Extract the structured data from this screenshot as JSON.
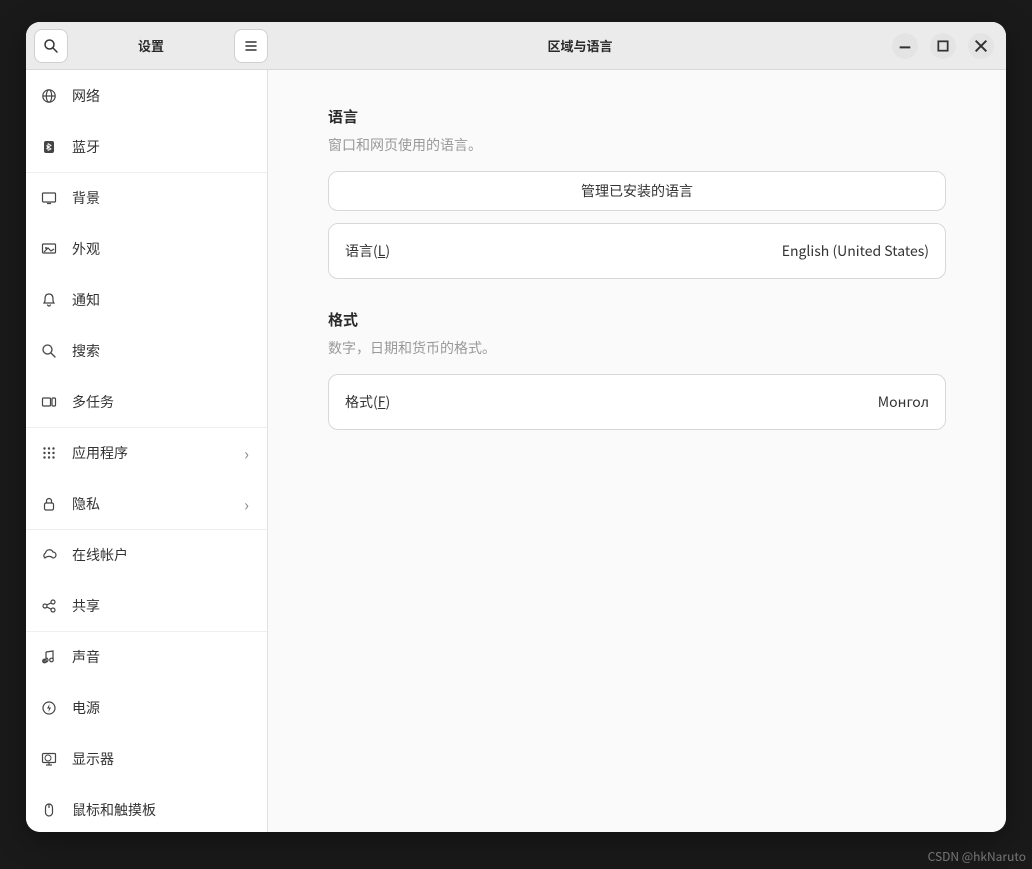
{
  "header": {
    "sidebar_title": "设置",
    "main_title": "区域与语言"
  },
  "sidebar": {
    "items": [
      {
        "id": "network",
        "label": "网络",
        "chevron": false,
        "sep": false
      },
      {
        "id": "bluetooth",
        "label": "蓝牙",
        "chevron": false,
        "sep": false
      },
      {
        "id": "background",
        "label": "背景",
        "chevron": false,
        "sep": true
      },
      {
        "id": "appearance",
        "label": "外观",
        "chevron": false,
        "sep": false
      },
      {
        "id": "notifications",
        "label": "通知",
        "chevron": false,
        "sep": false
      },
      {
        "id": "search",
        "label": "搜索",
        "chevron": false,
        "sep": false
      },
      {
        "id": "multitasking",
        "label": "多任务",
        "chevron": false,
        "sep": false
      },
      {
        "id": "applications",
        "label": "应用程序",
        "chevron": true,
        "sep": true
      },
      {
        "id": "privacy",
        "label": "隐私",
        "chevron": true,
        "sep": false
      },
      {
        "id": "online-accounts",
        "label": "在线帐户",
        "chevron": false,
        "sep": true
      },
      {
        "id": "sharing",
        "label": "共享",
        "chevron": false,
        "sep": false
      },
      {
        "id": "sound",
        "label": "声音",
        "chevron": false,
        "sep": true
      },
      {
        "id": "power",
        "label": "电源",
        "chevron": false,
        "sep": false
      },
      {
        "id": "displays",
        "label": "显示器",
        "chevron": false,
        "sep": false
      },
      {
        "id": "mouse",
        "label": "鼠标和触摸板",
        "chevron": false,
        "sep": false
      }
    ]
  },
  "content": {
    "language": {
      "heading": "语言",
      "description": "窗口和网页使用的语言。",
      "manage_button": "管理已安装的语言",
      "row_label_prefix": "语言(",
      "row_label_mnemonic": "L",
      "row_label_suffix": ")",
      "row_value": "English (United States)"
    },
    "formats": {
      "heading": "格式",
      "description": "数字，日期和货币的格式。",
      "row_label_prefix": "格式(",
      "row_label_mnemonic": "F",
      "row_label_suffix": ")",
      "row_value": "Монгол"
    }
  },
  "watermark": "CSDN @hkNaruto"
}
